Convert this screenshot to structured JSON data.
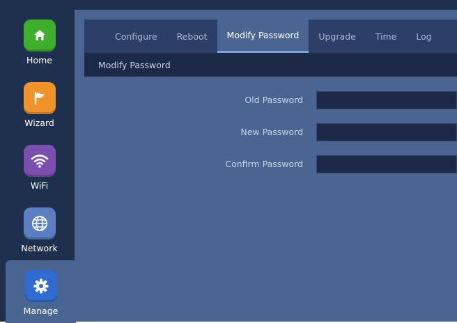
{
  "sidebar": {
    "items": [
      {
        "label": "Home",
        "icon": "home-icon",
        "color": "#3fae2a"
      },
      {
        "label": "Wizard",
        "icon": "flag-icon",
        "color": "#f0932b"
      },
      {
        "label": "WiFi",
        "icon": "wifi-icon",
        "color": "#7b4fb0"
      },
      {
        "label": "Network",
        "icon": "globe-icon",
        "color": "#5c7ec2"
      },
      {
        "label": "Manage",
        "icon": "gear-icon",
        "color": "#2f6bd1"
      }
    ],
    "active": "Manage"
  },
  "tabs": [
    {
      "label": "Configure"
    },
    {
      "label": "Reboot"
    },
    {
      "label": "Modify Password"
    },
    {
      "label": "Upgrade"
    },
    {
      "label": "Time"
    },
    {
      "label": "Log"
    }
  ],
  "active_tab": "Modify Password",
  "section": {
    "title": "Modify Password"
  },
  "form": {
    "old_password": {
      "label": "Old Password",
      "value": ""
    },
    "new_password": {
      "label": "New Password",
      "value": ""
    },
    "confirm_password": {
      "label": "Confirm Password",
      "value": ""
    }
  }
}
